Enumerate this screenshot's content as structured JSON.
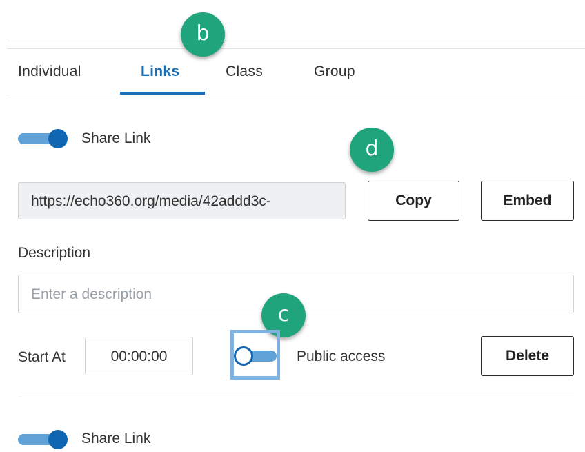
{
  "tabs": [
    {
      "label": "Individual"
    },
    {
      "label": "Links"
    },
    {
      "label": "Class"
    },
    {
      "label": "Group"
    }
  ],
  "active_tab": "Links",
  "badges": {
    "b": "b",
    "c": "c",
    "d": "d"
  },
  "share_link_1": {
    "label": "Share Link",
    "enabled": true
  },
  "link": {
    "url": "https://echo360.org/media/42addd3c-",
    "copy_label": "Copy",
    "embed_label": "Embed"
  },
  "description": {
    "label": "Description",
    "placeholder": "Enter a description",
    "value": ""
  },
  "start_at": {
    "label": "Start At",
    "value": "00:00:00"
  },
  "public_access": {
    "label": "Public access",
    "enabled": false
  },
  "delete_label": "Delete",
  "share_link_2": {
    "label": "Share Link",
    "enabled": true
  },
  "colors": {
    "accent": "#1b6fb5",
    "toggle_knob": "#1167b1",
    "toggle_track": "#5fa2d8",
    "badge": "#1fa47c",
    "highlight": "#7fb3df"
  }
}
